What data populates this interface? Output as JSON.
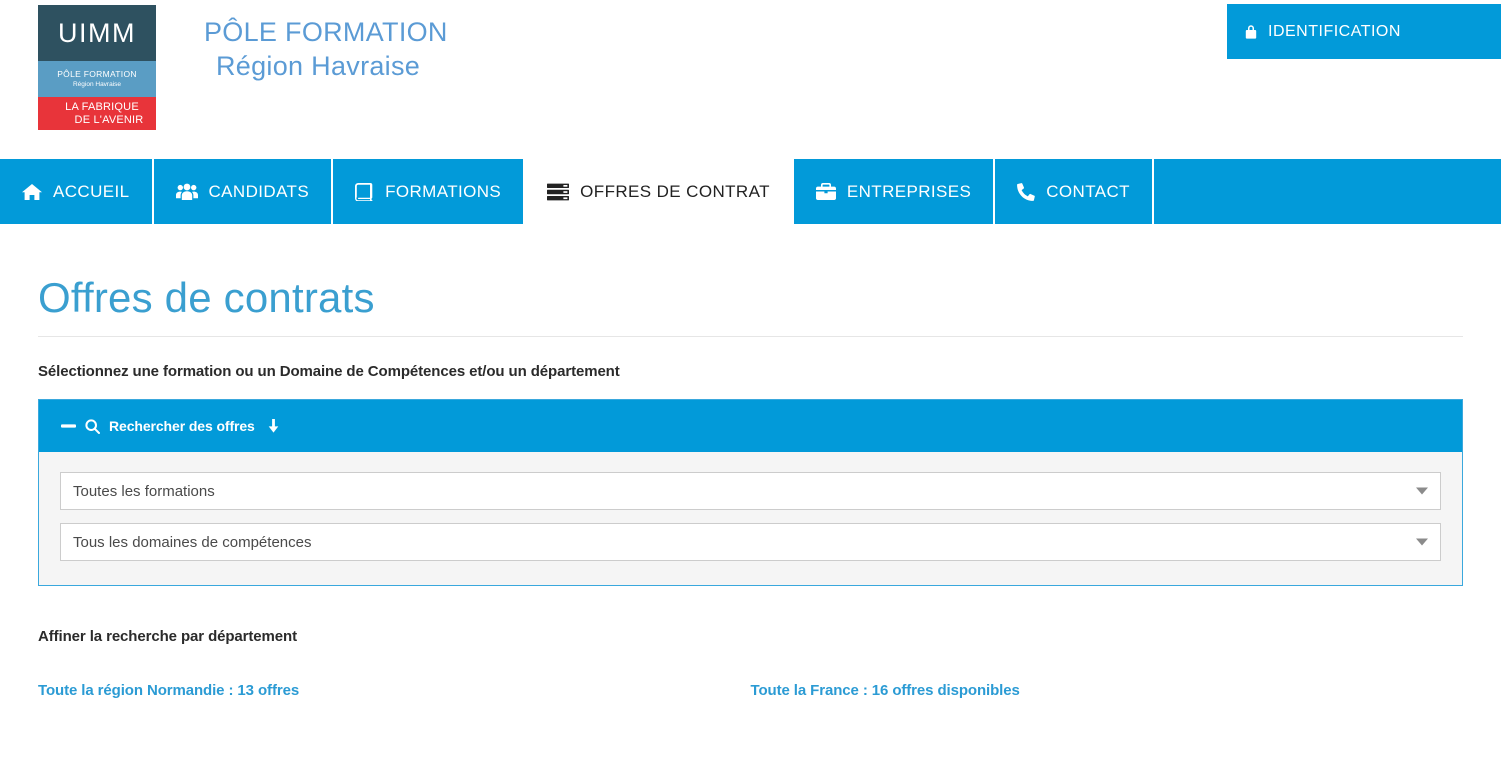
{
  "header": {
    "logo": {
      "uimm": "UIMM",
      "pole_formation": "PÔLE FORMATION",
      "region": "Région Havraise",
      "fabrique_line1": "LA FABRIQUE",
      "fabrique_line2": "DE L'AVENIR"
    },
    "title_line1": "PÔLE FORMATION",
    "title_line2": "Région Havraise",
    "identification_label": "IDENTIFICATION",
    "identification_icon": "lock-icon"
  },
  "nav": {
    "items": [
      {
        "label": "ACCUEIL",
        "icon": "home-icon",
        "active": false
      },
      {
        "label": "CANDIDATS",
        "icon": "users-icon",
        "active": false
      },
      {
        "label": "FORMATIONS",
        "icon": "book-icon",
        "active": false
      },
      {
        "label": "OFFRES DE CONTRAT",
        "icon": "server-list-icon",
        "active": true
      },
      {
        "label": "ENTREPRISES",
        "icon": "briefcase-icon",
        "active": false
      },
      {
        "label": "CONTACT",
        "icon": "phone-icon",
        "active": false
      }
    ]
  },
  "main": {
    "page_title": "Offres de contrats",
    "instruction": "Sélectionnez une formation ou un Domaine de Compétences et/ou un département",
    "search_panel": {
      "collapse_icon": "minus-icon",
      "search_icon": "search-icon",
      "title": "Rechercher des offres",
      "arrow_icon": "arrow-down-icon",
      "selects": [
        {
          "name": "formations-select",
          "value": "Toutes les formations",
          "caret_icon": "caret-down-icon"
        },
        {
          "name": "domaines-select",
          "value": "Tous les domaines de compétences",
          "caret_icon": "caret-down-icon"
        }
      ]
    },
    "department_label": "Affiner la recherche par département",
    "links": [
      {
        "label": "Toute la région Normandie : 13 offres"
      },
      {
        "label": "Toute la France : 16 offres disponibles"
      }
    ]
  },
  "colors": {
    "primary_blue": "#029ad9",
    "title_blue": "#3a9fd0",
    "brand_blue": "#5b9bd5",
    "link_blue": "#2b9bd4",
    "logo_dark": "#2e5160",
    "logo_mid": "#5a9dc4",
    "logo_red": "#e8343a",
    "panel_bg": "#f5f5f5"
  }
}
